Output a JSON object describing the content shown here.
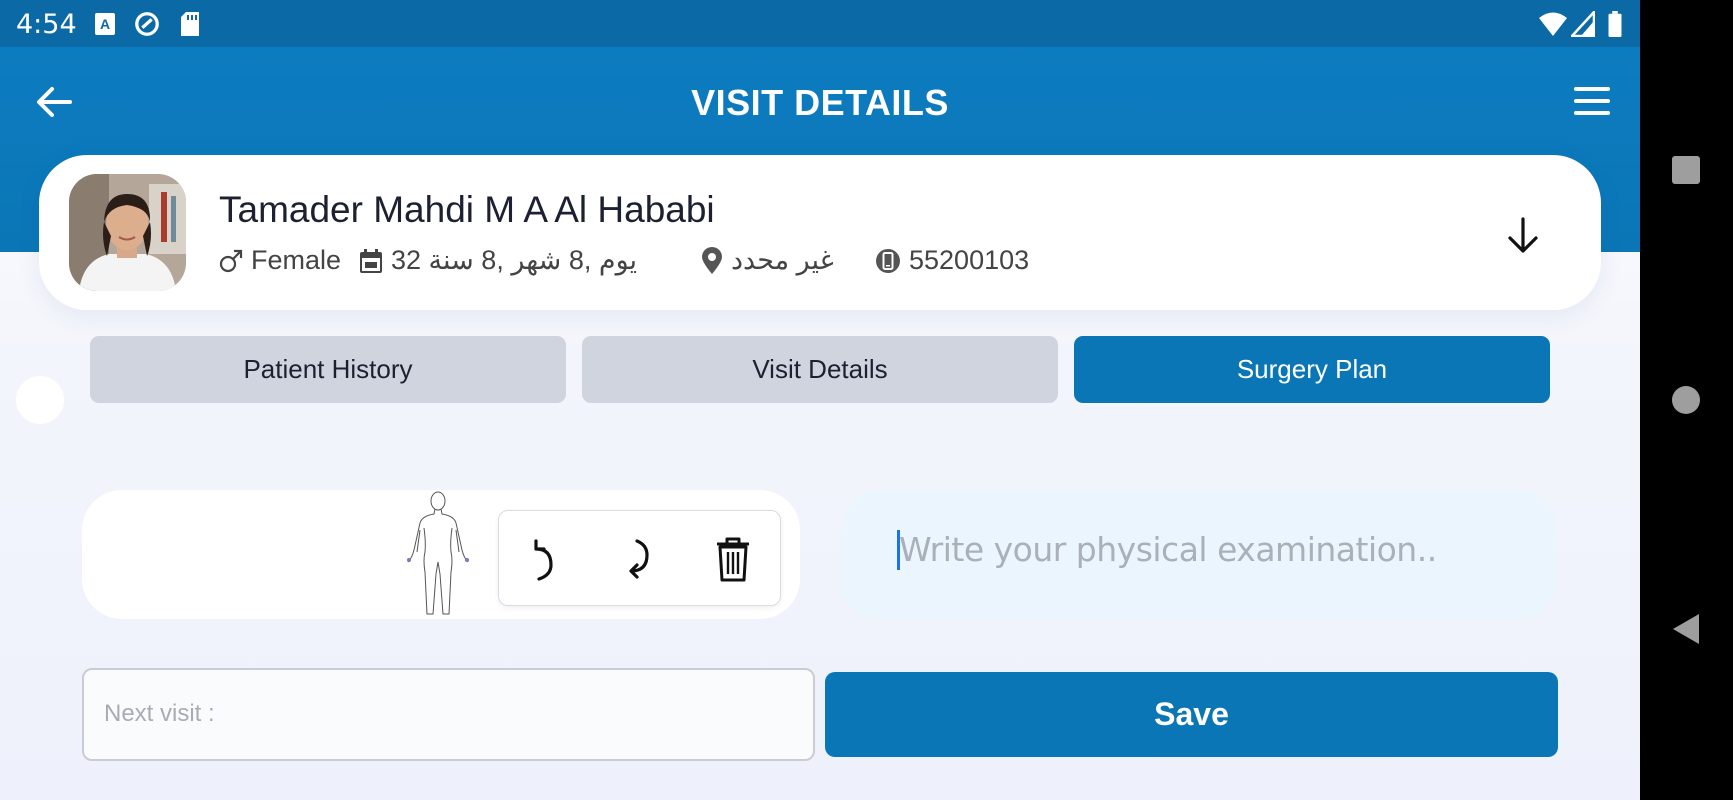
{
  "status_bar": {
    "time": "4:54"
  },
  "header": {
    "title": "VISIT DETAILS"
  },
  "patient": {
    "name": "Tamader Mahdi M A Al Hababi",
    "gender": "Female",
    "age": "32 يوم ,8 شهر ,8 سنة",
    "location": "غير محدد",
    "phone": "55200103"
  },
  "tabs": [
    {
      "label": "Patient History",
      "active": false
    },
    {
      "label": "Visit Details",
      "active": false
    },
    {
      "label": "Surgery Plan",
      "active": true
    }
  ],
  "exam": {
    "placeholder": "Write your physical examination.."
  },
  "next_visit": {
    "placeholder": "Next visit :"
  },
  "save_label": "Save",
  "colors": {
    "primary": "#0b76b6",
    "status_bar": "#0b6aa5",
    "tab_inactive": "#d0d4de",
    "exam_bg": "#ebf5fe"
  },
  "icons": {
    "back": "arrow-left-icon",
    "menu": "hamburger-icon",
    "expand": "arrow-down-icon",
    "gender": "male-symbol-icon",
    "age": "calendar-icon",
    "location": "map-pin-icon",
    "phone": "phone-icon",
    "undo": "undo-icon",
    "redo": "redo-icon",
    "delete": "trash-icon"
  }
}
